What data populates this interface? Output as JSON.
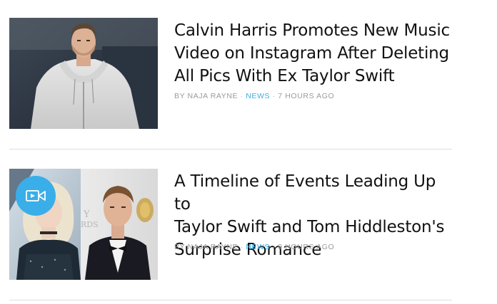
{
  "articles": [
    {
      "headline_lines": [
        "Calvin Harris Promotes New Music",
        "Video on Instagram After Deleting",
        "All Pics With Ex Taylor Swift"
      ],
      "byline_author": "BY NAJA RAYNE",
      "separator": " · ",
      "category": "NEWS",
      "timestamp": "7 HOURS AGO",
      "thumbnail": "man-in-grey-hoodie-photo",
      "has_video": false
    },
    {
      "headline_lines": [
        "A Timeline of Events Leading Up to",
        "Taylor Swift and Tom Hiddleston's",
        "Surprise Romance"
      ],
      "byline_author": "BY NAJA RAYNE",
      "separator": " · ",
      "category": "NEWS",
      "timestamp": "9 HOURS AGO",
      "thumbnail": "couple-red-carpet-photo",
      "has_video": true,
      "video_icon": "video-camera-icon",
      "background_text": "Y\nRDS"
    }
  ],
  "colors": {
    "category": "#3aaee8",
    "byline": "#9a9a9a",
    "headline": "#111111",
    "divider": "#dedede",
    "video_badge": "#3aaee8"
  }
}
